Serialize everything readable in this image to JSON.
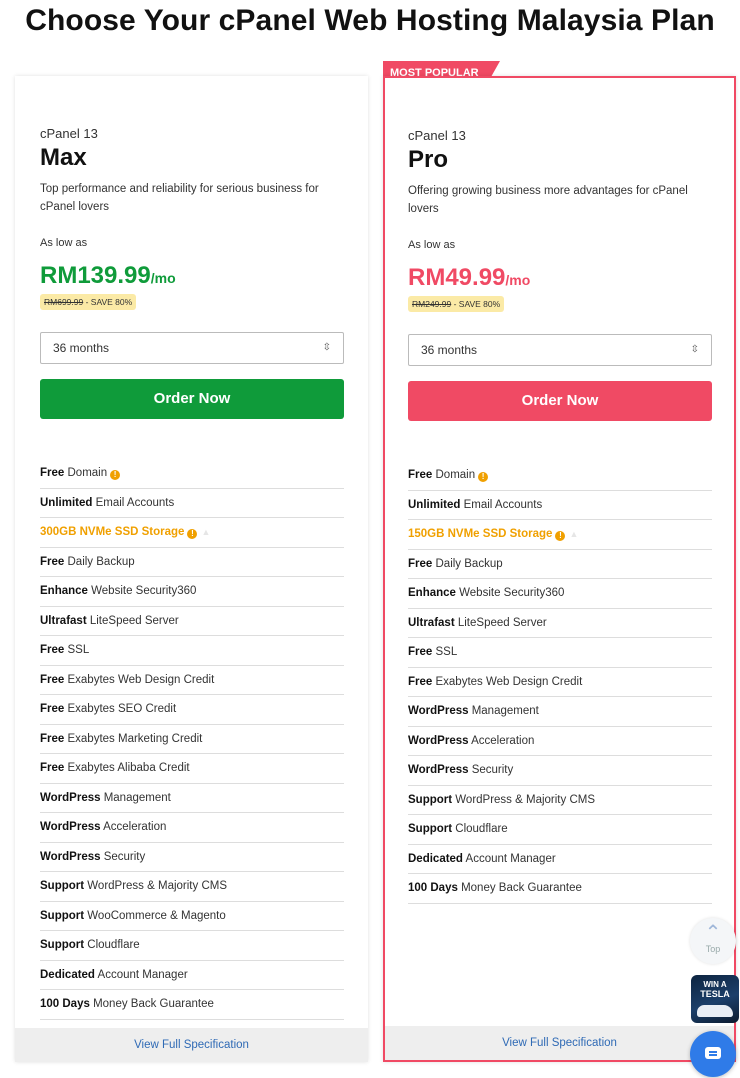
{
  "page_title": "Choose Your cPanel Web Hosting Malaysia Plan",
  "badge": "MOST POPULAR",
  "plans": [
    {
      "subtitle": "cPanel 13",
      "name": "Max",
      "description": "Top performance and reliability for serious business for cPanel lovers",
      "as_low_as": "As low as",
      "price": "RM139.99",
      "per": "/mo",
      "original_price": "RM699.99",
      "save": " - SAVE 80%",
      "term": "36 months",
      "order_label": "Order Now",
      "spec_link": "View Full Specification",
      "color": "#0f9b3a",
      "features": [
        {
          "bold": "Free",
          "text": " Domain",
          "info": true
        },
        {
          "bold": "Unlimited",
          "text": " Email Accounts"
        },
        {
          "bold": "",
          "text": "300GB NVMe SSD Storage",
          "info": true,
          "highlight": true
        },
        {
          "bold": "Free",
          "text": " Daily Backup"
        },
        {
          "bold": "Enhance",
          "text": " Website Security360"
        },
        {
          "bold": "Ultrafast",
          "text": " LiteSpeed Server"
        },
        {
          "bold": "Free",
          "text": " SSL"
        },
        {
          "bold": "Free",
          "text": " Exabytes Web Design Credit"
        },
        {
          "bold": "Free",
          "text": " Exabytes SEO Credit"
        },
        {
          "bold": "Free",
          "text": " Exabytes Marketing Credit"
        },
        {
          "bold": "Free",
          "text": " Exabytes Alibaba Credit"
        },
        {
          "bold": "WordPress",
          "text": " Management"
        },
        {
          "bold": "WordPress",
          "text": " Acceleration"
        },
        {
          "bold": "WordPress",
          "text": " Security"
        },
        {
          "bold": "Support",
          "text": " WordPress & Majority CMS"
        },
        {
          "bold": "Support",
          "text": " WooCommerce & Magento"
        },
        {
          "bold": "Support",
          "text": " Cloudflare"
        },
        {
          "bold": "Dedicated",
          "text": " Account Manager"
        },
        {
          "bold": "100 Days",
          "text": " Money Back Guarantee"
        }
      ]
    },
    {
      "subtitle": "cPanel 13",
      "name": "Pro",
      "description": "Offering growing business more advantages for cPanel lovers",
      "as_low_as": "As low as",
      "price": "RM49.99",
      "per": "/mo",
      "original_price": "RM249.99",
      "save": " - SAVE 80%",
      "term": "36 months",
      "order_label": "Order Now",
      "spec_link": "View Full Specification",
      "color": "#f04a64",
      "features": [
        {
          "bold": "Free",
          "text": " Domain",
          "info": true
        },
        {
          "bold": "Unlimited",
          "text": " Email Accounts"
        },
        {
          "bold": "",
          "text": "150GB NVMe SSD Storage",
          "info": true,
          "highlight": true
        },
        {
          "bold": "Free",
          "text": " Daily Backup"
        },
        {
          "bold": "Enhance",
          "text": " Website Security360"
        },
        {
          "bold": "Ultrafast",
          "text": " LiteSpeed Server"
        },
        {
          "bold": "Free",
          "text": " SSL"
        },
        {
          "bold": "Free",
          "text": " Exabytes Web Design Credit"
        },
        {
          "bold": "WordPress",
          "text": " Management"
        },
        {
          "bold": "WordPress",
          "text": " Acceleration"
        },
        {
          "bold": "WordPress",
          "text": " Security"
        },
        {
          "bold": "Support",
          "text": " WordPress & Majority CMS"
        },
        {
          "bold": "Support",
          "text": " Cloudflare"
        },
        {
          "bold": "Dedicated",
          "text": " Account Manager"
        },
        {
          "bold": "100 Days",
          "text": " Money Back Guarantee"
        }
      ]
    }
  ],
  "widgets": {
    "top_label": "Top",
    "promo_line1": "WIN A",
    "promo_line2": "TESLA",
    "info_glyph": "!",
    "chevron_glyph": "⌃⌄",
    "top_glyph": "︿",
    "icons": [
      "info-icon",
      "hd-icon",
      "chevron-updown-icon",
      "arrow-up-icon",
      "chat-icon"
    ]
  }
}
